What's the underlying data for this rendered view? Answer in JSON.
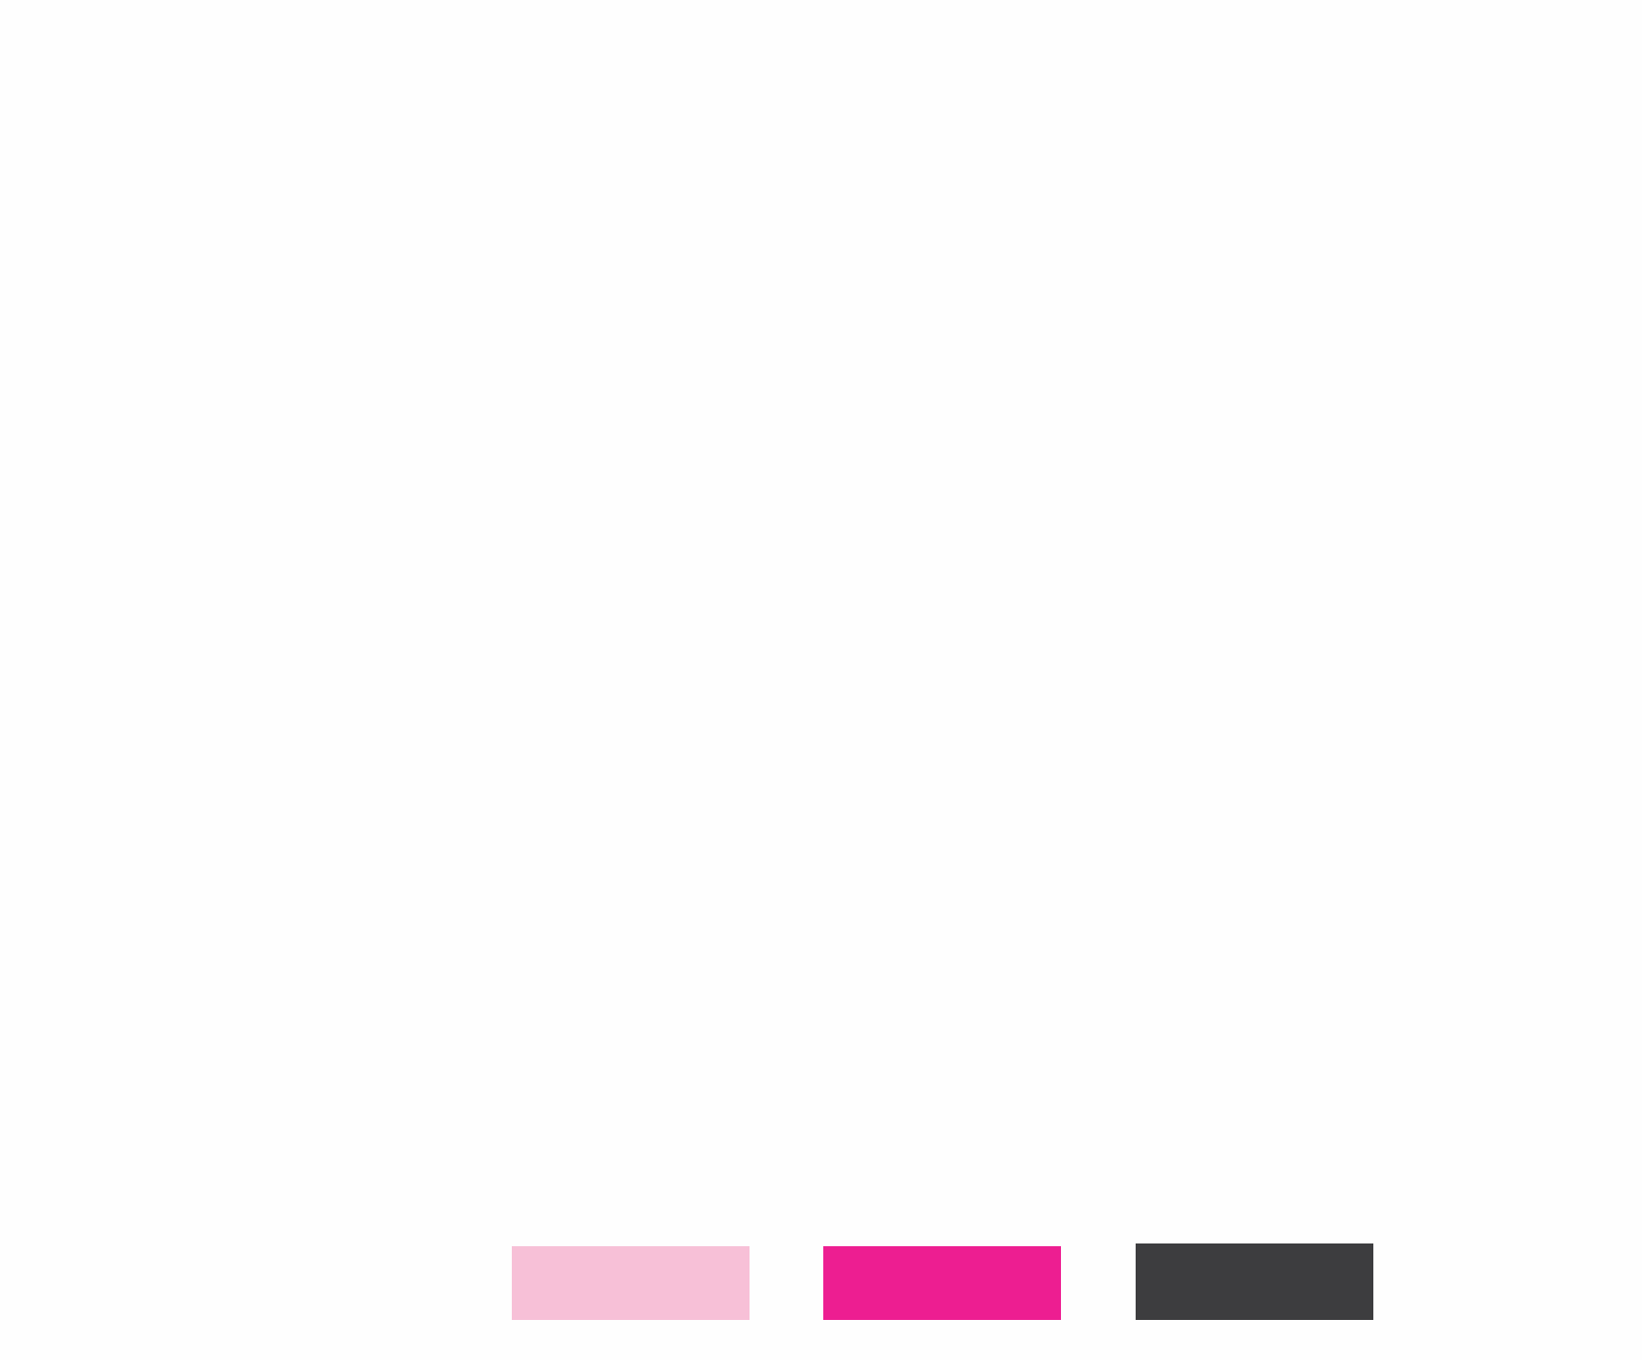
{
  "swatches": [
    {
      "name": "light-pink",
      "color": "#f7c0d7"
    },
    {
      "name": "magenta",
      "color": "#ed1e91"
    },
    {
      "name": "dark-gray",
      "color": "#3d3d3f"
    }
  ]
}
